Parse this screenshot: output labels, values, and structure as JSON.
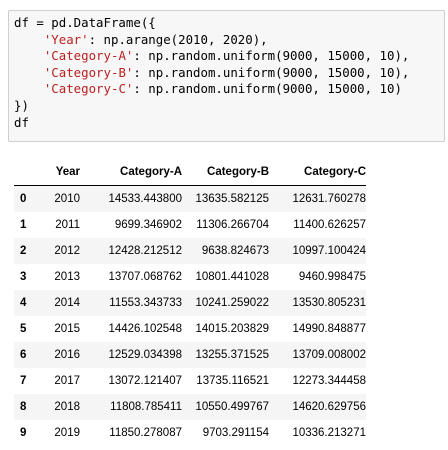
{
  "code_cell": {
    "lines": [
      [
        {
          "t": "df = pd.DataFrame({",
          "c": "op"
        }
      ],
      [
        {
          "t": "    ",
          "c": "op"
        },
        {
          "t": "'Year'",
          "c": "str"
        },
        {
          "t": ": np.arange(2010, 2020),",
          "c": "op"
        }
      ],
      [
        {
          "t": "    ",
          "c": "op"
        },
        {
          "t": "'Category-A'",
          "c": "str"
        },
        {
          "t": ": np.random.uniform(9000, 15000, 10),",
          "c": "op"
        }
      ],
      [
        {
          "t": "    ",
          "c": "op"
        },
        {
          "t": "'Category-B'",
          "c": "str"
        },
        {
          "t": ": np.random.uniform(9000, 15000, 10),",
          "c": "op"
        }
      ],
      [
        {
          "t": "    ",
          "c": "op"
        },
        {
          "t": "'Category-C'",
          "c": "str"
        },
        {
          "t": ": np.random.uniform(9000, 15000, 10)",
          "c": "op"
        }
      ],
      [
        {
          "t": "})",
          "c": "op"
        }
      ],
      [
        {
          "t": "df",
          "c": "op"
        }
      ]
    ]
  },
  "table": {
    "columns": [
      "",
      "Year",
      "Category-A",
      "Category-B",
      "Category-C"
    ],
    "rows": [
      {
        "index": "0",
        "year": "2010",
        "a": "14533.443800",
        "b": "13635.582125",
        "c": "12631.760278"
      },
      {
        "index": "1",
        "year": "2011",
        "a": "9699.346902",
        "b": "11306.266704",
        "c": "11400.626257"
      },
      {
        "index": "2",
        "year": "2012",
        "a": "12428.212512",
        "b": "9638.824673",
        "c": "10997.100424"
      },
      {
        "index": "3",
        "year": "2013",
        "a": "13707.068762",
        "b": "10801.441028",
        "c": "9460.998475"
      },
      {
        "index": "4",
        "year": "2014",
        "a": "11553.343733",
        "b": "10241.259022",
        "c": "13530.805231"
      },
      {
        "index": "5",
        "year": "2015",
        "a": "14426.102548",
        "b": "14015.203829",
        "c": "14990.848877"
      },
      {
        "index": "6",
        "year": "2016",
        "a": "12529.034398",
        "b": "13255.371525",
        "c": "13709.008002"
      },
      {
        "index": "7",
        "year": "2017",
        "a": "13072.121407",
        "b": "13735.116521",
        "c": "12273.344458"
      },
      {
        "index": "8",
        "year": "2018",
        "a": "11808.785411",
        "b": "10550.499767",
        "c": "14620.629756"
      },
      {
        "index": "9",
        "year": "2019",
        "a": "11850.278087",
        "b": "9703.291154",
        "c": "10336.213271"
      }
    ]
  }
}
